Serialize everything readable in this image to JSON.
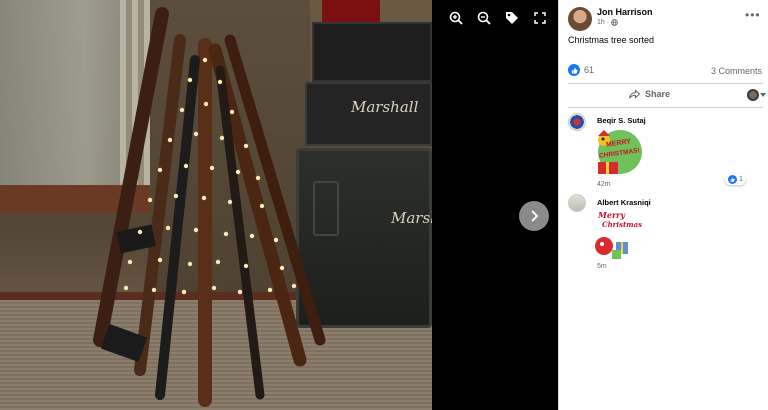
{
  "post": {
    "author": "Jon Harrison",
    "time": "1h",
    "privacy_icon": "globe-icon",
    "text": "Christmas tree sorted",
    "reactions": {
      "like_count": "61"
    },
    "comments_label": "3 Comments",
    "share_label": "Share"
  },
  "photo": {
    "amp_brand_top": "Marshall",
    "amp_brand_cab": "Marshall"
  },
  "toolbar": [
    "zoom-in-icon",
    "zoom-out-icon",
    "tag-icon",
    "fullscreen-icon"
  ],
  "comments": [
    {
      "name": "Beqir S. Sutaj",
      "time": "42m",
      "sticker_text": [
        "MERRY",
        "CHRISTMAS!"
      ],
      "reaction_count": "1"
    },
    {
      "name": "Albert Krasniqi",
      "time": "5m",
      "sticker_text": [
        "Merry",
        "Christmas"
      ]
    }
  ],
  "colors": {
    "like_blue": "#1877f2",
    "text_secondary": "#65676b"
  }
}
